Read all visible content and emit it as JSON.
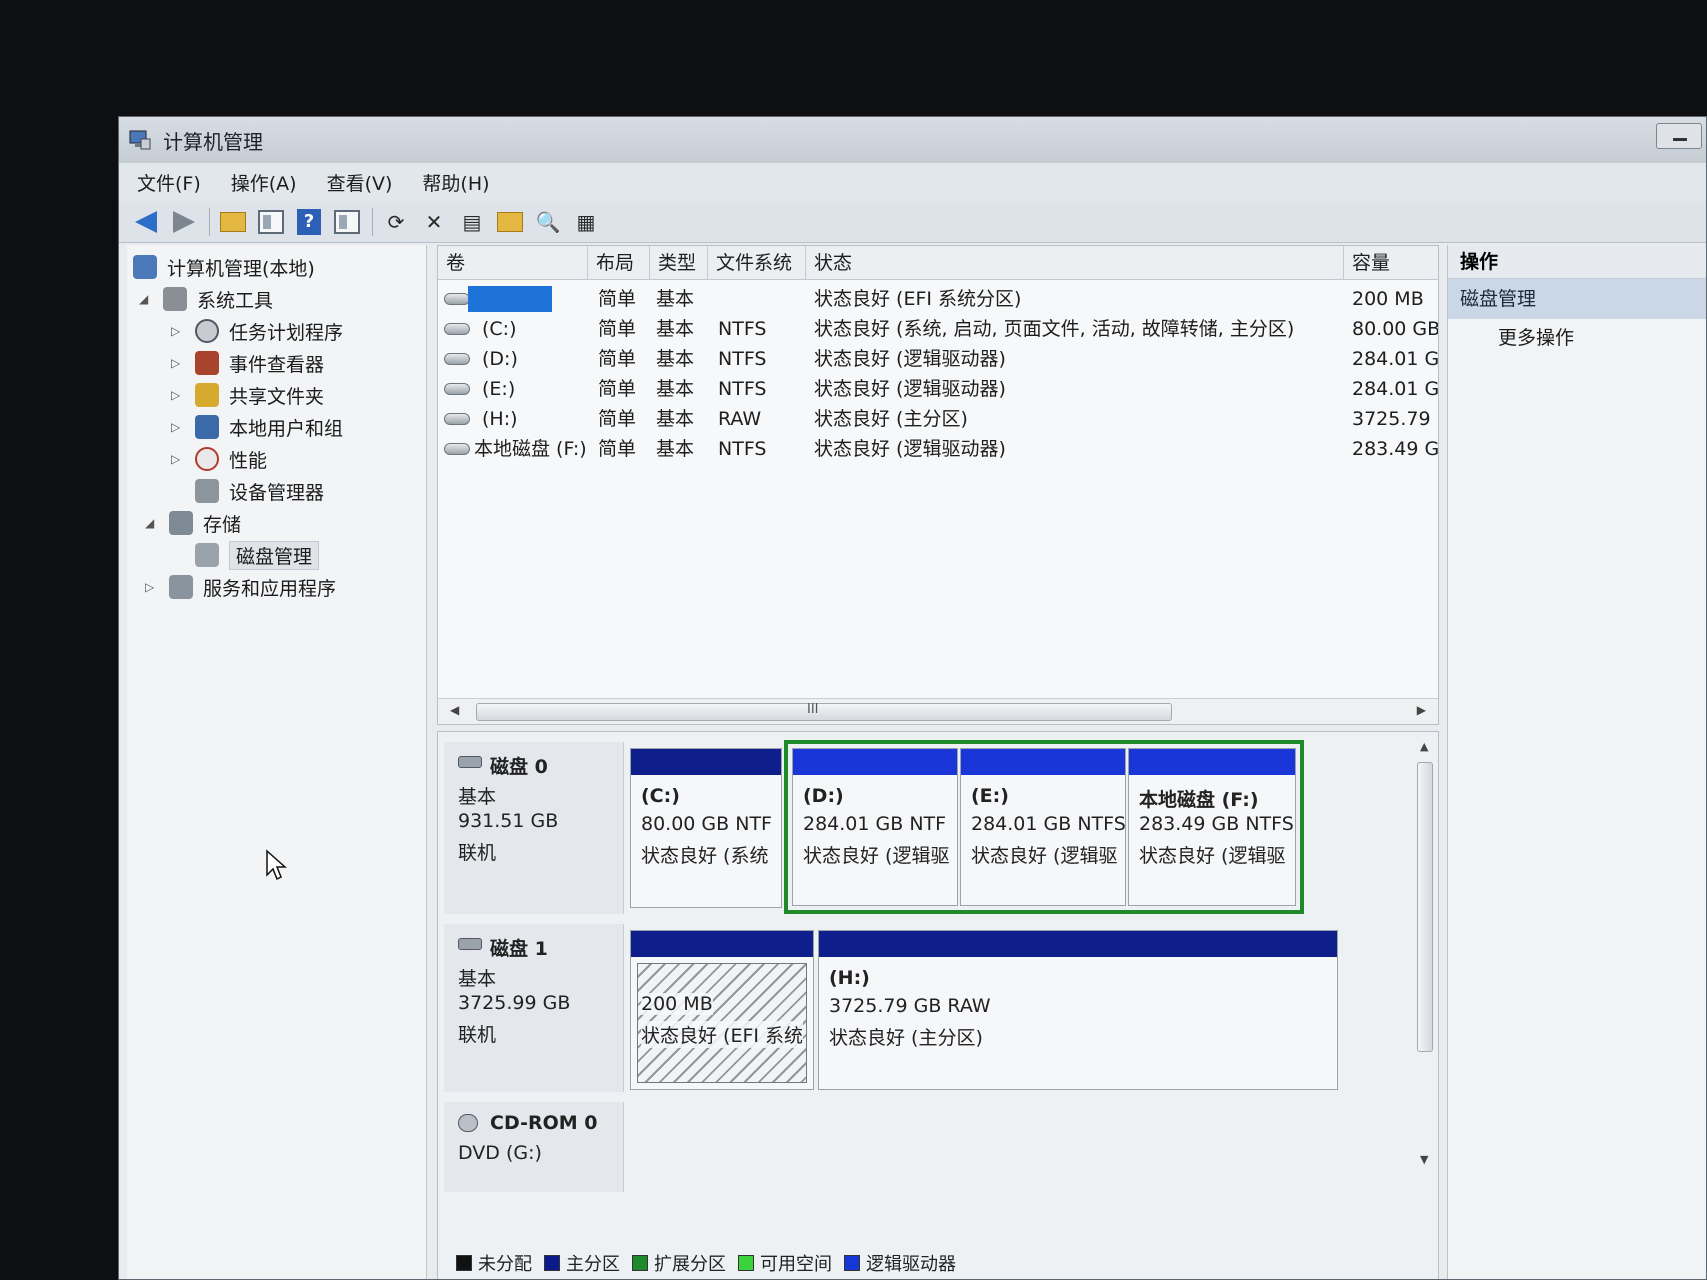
{
  "window": {
    "title": "计算机管理"
  },
  "menu": [
    "文件(F)",
    "操作(A)",
    "查看(V)",
    "帮助(H)"
  ],
  "tree": {
    "root": "计算机管理(本地)",
    "system_tools": "系统工具",
    "task_scheduler": "任务计划程序",
    "event_viewer": "事件查看器",
    "shared_folders": "共享文件夹",
    "local_users": "本地用户和组",
    "performance": "性能",
    "device_manager": "设备管理器",
    "storage": "存储",
    "disk_management": "磁盘管理",
    "services": "服务和应用程序"
  },
  "volume_table": {
    "headers": [
      "卷",
      "布局",
      "类型",
      "文件系统",
      "状态",
      "容量"
    ],
    "rows": [
      {
        "volume": "",
        "layout": "简单",
        "type": "基本",
        "fs": "",
        "status": "状态良好 (EFI 系统分区)",
        "capacity": "200 MB"
      },
      {
        "volume": "(C:)",
        "layout": "简单",
        "type": "基本",
        "fs": "NTFS",
        "status": "状态良好 (系统, 启动, 页面文件, 活动, 故障转储, 主分区)",
        "capacity": "80.00 GB"
      },
      {
        "volume": "(D:)",
        "layout": "简单",
        "type": "基本",
        "fs": "NTFS",
        "status": "状态良好 (逻辑驱动器)",
        "capacity": "284.01 G"
      },
      {
        "volume": "(E:)",
        "layout": "简单",
        "type": "基本",
        "fs": "NTFS",
        "status": "状态良好 (逻辑驱动器)",
        "capacity": "284.01 G"
      },
      {
        "volume": "(H:)",
        "layout": "简单",
        "type": "基本",
        "fs": "RAW",
        "status": "状态良好 (主分区)",
        "capacity": "3725.79 ("
      },
      {
        "volume": "本地磁盘 (F:)",
        "layout": "简单",
        "type": "基本",
        "fs": "NTFS",
        "status": "状态良好 (逻辑驱动器)",
        "capacity": "283.49 G"
      }
    ]
  },
  "scrollbar_mark": "III",
  "disks": {
    "disk0": {
      "name": "磁盘 0",
      "kind": "基本",
      "size": "931.51 GB",
      "state": "联机"
    },
    "disk1": {
      "name": "磁盘 1",
      "kind": "基本",
      "size": "3725.99 GB",
      "state": "联机"
    },
    "cdrom": {
      "name": "CD-ROM 0",
      "kind": "DVD (G:)"
    }
  },
  "partitions": {
    "c": {
      "name": "(C:)",
      "size": "80.00 GB NTF",
      "status": "状态良好 (系统"
    },
    "d": {
      "name": "(D:)",
      "size": "284.01 GB NTF",
      "status": "状态良好 (逻辑驱"
    },
    "e": {
      "name": "(E:)",
      "size": "284.01 GB NTFS",
      "status": "状态良好 (逻辑驱"
    },
    "f": {
      "name": "本地磁盘 (F:)",
      "size": "283.49 GB NTFS",
      "status": "状态良好 (逻辑驱"
    },
    "efi": {
      "size": "200 MB",
      "status": "状态良好 (EFI 系统"
    },
    "h": {
      "name": "(H:)",
      "size": "3725.79 GB RAW",
      "status": "状态良好 (主分区)"
    }
  },
  "legend": [
    {
      "label": "未分配",
      "color": "#111111"
    },
    {
      "label": "主分区",
      "color": "#0a1a8a"
    },
    {
      "label": "扩展分区",
      "color": "#1f8a2a"
    },
    {
      "label": "可用空间",
      "color": "#3bd23b"
    },
    {
      "label": "逻辑驱动器",
      "color": "#1537d6"
    }
  ],
  "actions": {
    "header": "操作",
    "section": "磁盘管理",
    "more": "更多操作"
  },
  "colors": {
    "primary_band": "#0e1f8c",
    "logical_band": "#1a35d8",
    "extended_frame": "#1f8a2a",
    "selection": "#1e73d8"
  }
}
